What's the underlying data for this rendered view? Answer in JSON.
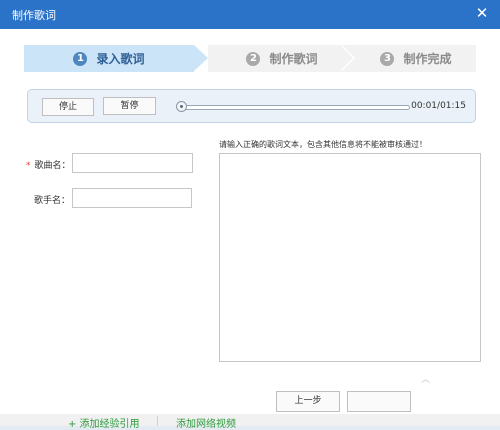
{
  "window": {
    "title": "制作歌词",
    "close_glyph": "✕"
  },
  "steps": [
    {
      "num": "1",
      "label": "录入歌词",
      "state": "active"
    },
    {
      "num": "2",
      "label": "制作歌词",
      "state": "inactive"
    },
    {
      "num": "3",
      "label": "制作完成",
      "state": "inactive"
    }
  ],
  "player": {
    "stop_label": "停止",
    "pause_label": "暂停",
    "time": "00:01/01:15",
    "progress_fraction": 0.013
  },
  "form": {
    "song_name_required": "*",
    "song_name_label": "歌曲名：",
    "song_name_value": "",
    "singer_label": "歌手名：",
    "singer_value": "",
    "lyrics_hint": "请输入正确的歌词文本，包含其他信息将不能被审核通过！",
    "lyrics_value": ""
  },
  "footer": {
    "prev_label": "上一步",
    "next_label": ""
  },
  "background": {
    "link1": "+ 添加经验引用",
    "link2": "添加网络视频"
  },
  "colors": {
    "titlebar": "#2b73c8",
    "active_step": "#cbe4f7",
    "required": "#e0403a"
  }
}
